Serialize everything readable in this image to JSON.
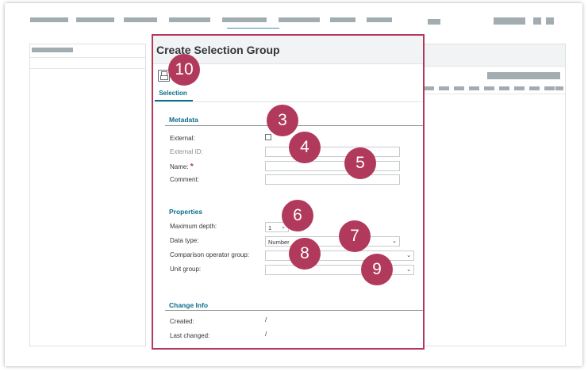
{
  "dialog": {
    "title": "Create Selection Group",
    "tab_selection": "Selection",
    "metadata": {
      "title": "Metadata",
      "external_label": "External:",
      "external_id_label": "External ID:",
      "name_label": "Name:",
      "name_required": "*",
      "comment_label": "Comment:"
    },
    "properties": {
      "title": "Properties",
      "max_depth_label": "Maximum depth:",
      "max_depth_value": "1",
      "data_type_label": "Data type:",
      "data_type_value": "Number",
      "comparison_label": "Comparison operator group:",
      "comparison_value": "",
      "unit_group_label": "Unit group:",
      "unit_group_value": ""
    },
    "change_info": {
      "title": "Change Info",
      "created_label": "Created:",
      "created_value": "/",
      "last_changed_label": "Last changed:",
      "last_changed_value": "/"
    }
  },
  "callouts": {
    "c10": "10",
    "c3": "3",
    "c4": "4",
    "c5": "5",
    "c6": "6",
    "c7": "7",
    "c8": "8",
    "c9": "9"
  },
  "icons": {
    "save": "save-icon",
    "dropdown": "chevron-down-icon"
  },
  "colors": {
    "accent": "#b1395c",
    "section": "#0a6e8b",
    "placeholder": "#a3acb1"
  }
}
